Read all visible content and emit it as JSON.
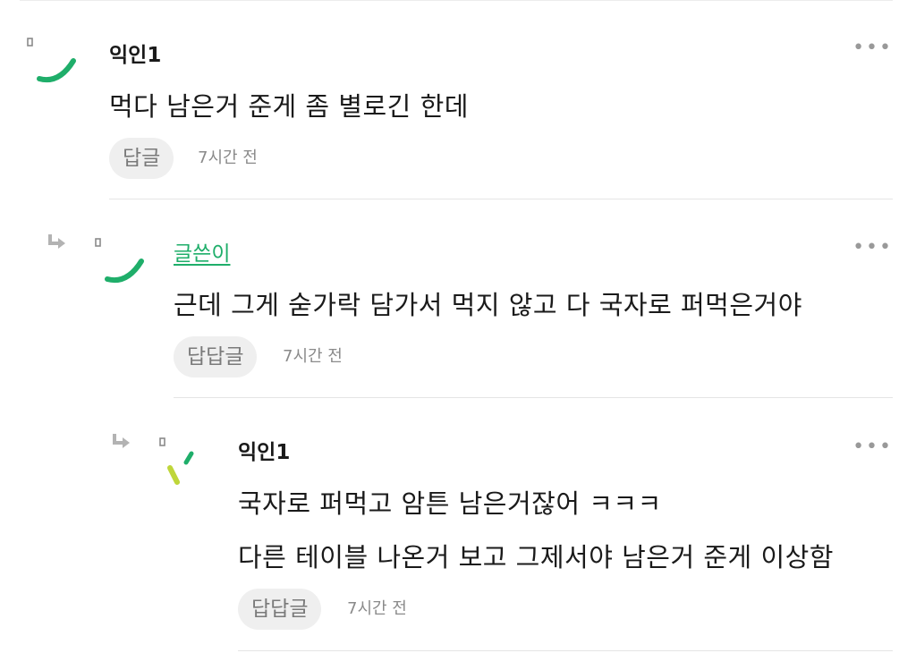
{
  "comments": [
    {
      "author": "익인1",
      "lines": [
        "먹다 남은거 준게 좀 별로긴 한데"
      ],
      "reply_label": "답글",
      "time": "7시간 전",
      "more_icon": "more-horizontal-icon",
      "avatar_icon": "smile-avatar-icon",
      "avatar_color": "#1fae6a"
    },
    {
      "author": "글쓴이",
      "is_writer": true,
      "lines": [
        "근데 그게 숟가락 담가서 먹지 않고 다 국자로 퍼먹은거야"
      ],
      "reply_label": "답답글",
      "time": "7시간 전",
      "more_icon": "more-horizontal-icon",
      "avatar_icon": "smile-avatar-icon",
      "avatar_color": "#1fae6a",
      "reply_arrow_icon": "reply-arrow-icon"
    },
    {
      "author": "익인1",
      "lines": [
        "국자로 퍼먹고 암튼 남은거잖어 ㅋㅋㅋ",
        "다른 테이블 나온거 보고 그제서야 남은거 준게 이상함"
      ],
      "reply_label": "답답글",
      "time": "7시간 전",
      "more_icon": "more-horizontal-icon",
      "avatar_icon": "sweat-avatar-icon",
      "avatar_color": "#bfd63a",
      "reply_arrow_icon": "reply-arrow-icon"
    }
  ]
}
